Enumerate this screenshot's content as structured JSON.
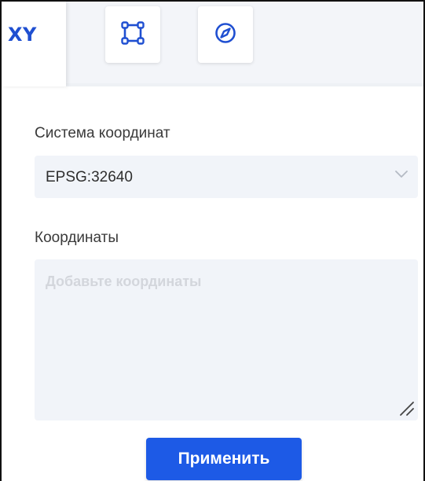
{
  "tabs": {
    "xy_label": "XY",
    "rect_icon": "square-corners-icon",
    "compass_icon": "compass-icon",
    "active": "XY"
  },
  "form": {
    "crs_label": "Система координат",
    "crs_value": "EPSG:32640",
    "coords_label": "Координаты",
    "coords_placeholder": "Добавьте координаты",
    "coords_value": ""
  },
  "actions": {
    "apply_label": "Применить"
  },
  "colors": {
    "accent": "#1d5ae6",
    "tab_icon": "#1f4fd1",
    "field_background": "#f1f4f9"
  }
}
